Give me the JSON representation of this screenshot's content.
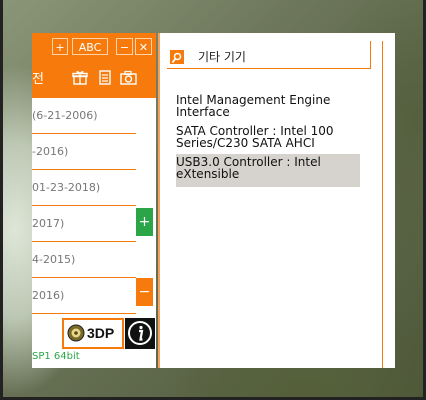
{
  "app": {
    "header": {
      "plus_label": "+",
      "abc_label": "ABC",
      "minimize_label": "−",
      "close_label": "✕",
      "title_fragment": "전"
    },
    "list_items": [
      "(6-21-2006)",
      "-2016)",
      "01-23-2018)",
      "2017)",
      "4-2015)",
      "2016)"
    ],
    "side_buttons": {
      "add_label": "+",
      "remove_label": "−"
    },
    "bottom": {
      "btn_3dp_label": "3DP",
      "os_text": "SP1 64bit"
    }
  },
  "panel": {
    "title": "기타 기기",
    "devices": [
      {
        "label": "Intel Management Engine Interface",
        "selected": false
      },
      {
        "label": "SATA Controller : Intel 100 Series/C230 SATA AHCI",
        "selected": false
      },
      {
        "label": "USB3.0 Controller : Intel eXtensible",
        "selected": true
      }
    ]
  },
  "colors": {
    "accent": "#f77b0c",
    "green": "#2aa648",
    "selected_bg": "#d6d3cf"
  }
}
